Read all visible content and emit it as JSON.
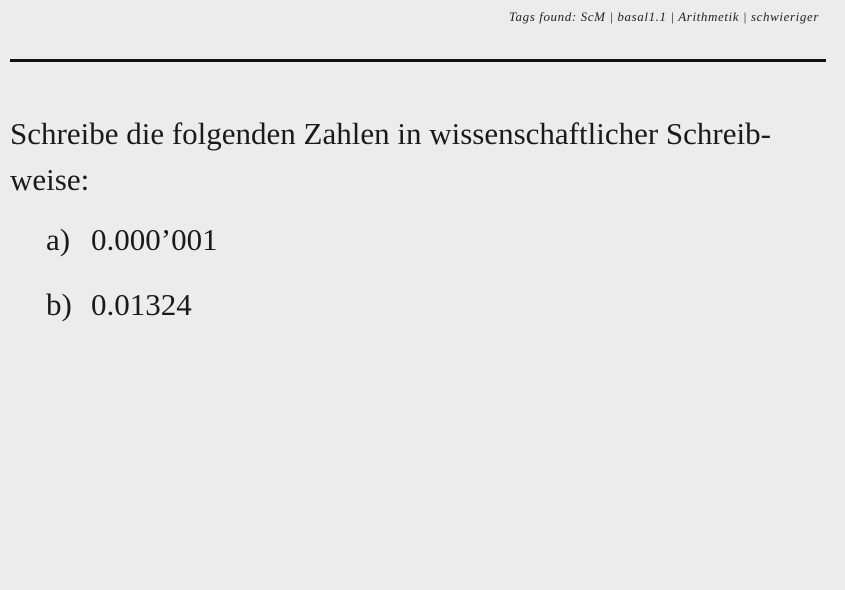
{
  "header": {
    "tags_text": "Tags found: ScM | basal1.1 | Arithmetik | schwieriger"
  },
  "question": {
    "line1": "Schreibe die folgenden Zahlen in wissenschaftlicher Schreib-",
    "line2": "weise:"
  },
  "items": [
    {
      "label": "a)",
      "value": "0.000’001"
    },
    {
      "label": "b)",
      "value": "0.01324"
    }
  ]
}
